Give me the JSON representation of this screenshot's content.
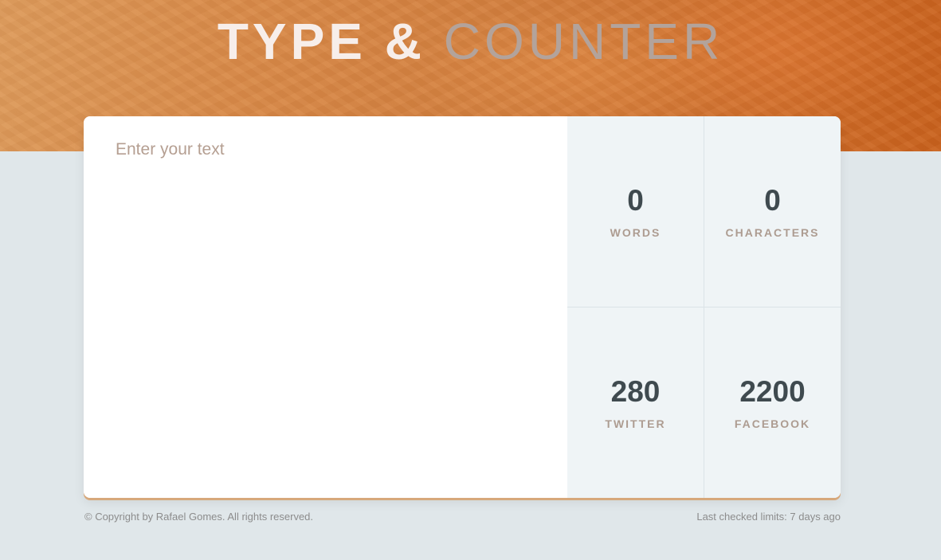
{
  "header": {
    "title_strong": "TYPE &",
    "title_light": "COUNTER"
  },
  "editor": {
    "placeholder": "Enter your text",
    "value": ""
  },
  "stats": [
    {
      "value": "0",
      "label": "WORDS"
    },
    {
      "value": "0",
      "label": "CHARACTERS"
    },
    {
      "value": "280",
      "label": "TWITTER"
    },
    {
      "value": "2200",
      "label": "FACEBOOK"
    }
  ],
  "footer": {
    "copyright": "© Copyright by Rafael Gomes. All rights reserved.",
    "last_checked": "Last checked limits: 7 days ago"
  },
  "colors": {
    "accent": "#d07a3a",
    "background": "#e0e7ea",
    "stat_value": "#3f4a4f",
    "stat_label": "#ad9c91"
  }
}
